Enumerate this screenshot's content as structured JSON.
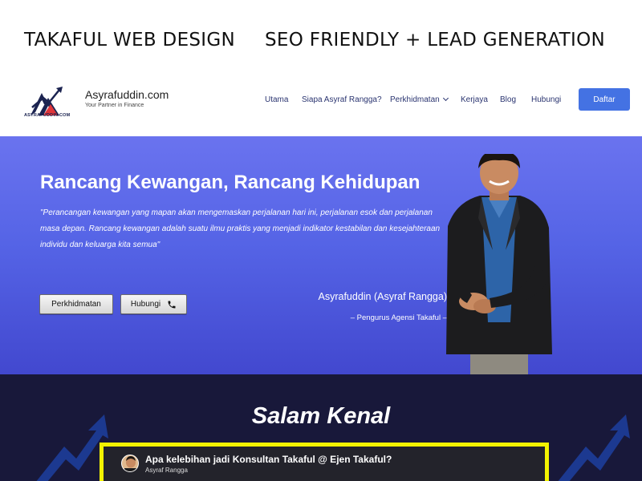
{
  "banner": {
    "left_caption": "TAKAFUL WEB DESIGN",
    "right_caption": "SEO FRIENDLY + LEAD GENERATION"
  },
  "header": {
    "logo_small_text": "ASYRAFUDDIN.COM",
    "brand_name": "Asyrafuddin.com",
    "brand_tagline": "Your Partner in Finance",
    "nav": [
      {
        "label": "Utama"
      },
      {
        "label": "Siapa Asyraf Rangga?"
      },
      {
        "label": "Perkhidmatan",
        "has_dropdown": true
      },
      {
        "label": "Kerjaya"
      },
      {
        "label": "Blog"
      },
      {
        "label": "Hubungi"
      }
    ],
    "cta_label": "Daftar",
    "cta_color": "#4472e3"
  },
  "hero": {
    "title": "Rancang Kewangan, Rancang Kehidupan",
    "quote": "\"Perancangan kewangan yang mapan akan mengemaskan perjalanan hari ini, perjalanan esok dan perjalanan masa depan. Rancang kewangan adalah suatu ilmu praktis yang menjadi indikator kestabilan dan kesejahteraan individu dan keluarga kita semua\"",
    "buttons": [
      {
        "label": "Perkhidmatan"
      },
      {
        "label": "Hubungi",
        "icon": "phone-icon"
      }
    ],
    "person_name": "Asyrafuddin (Asyraf Rangga)",
    "person_role": "– Pengurus Agensi Takaful –",
    "gradient_colors": [
      "#6a73ef",
      "#4248cf"
    ]
  },
  "section": {
    "heading": "Salam Kenal",
    "background": "#18183a",
    "video": {
      "title": "Apa kelebihan jadi Konsultan Takaful @ Ejen Takaful?",
      "channel": "Asyraf Rangga",
      "frame_color": "#f2f200"
    }
  }
}
